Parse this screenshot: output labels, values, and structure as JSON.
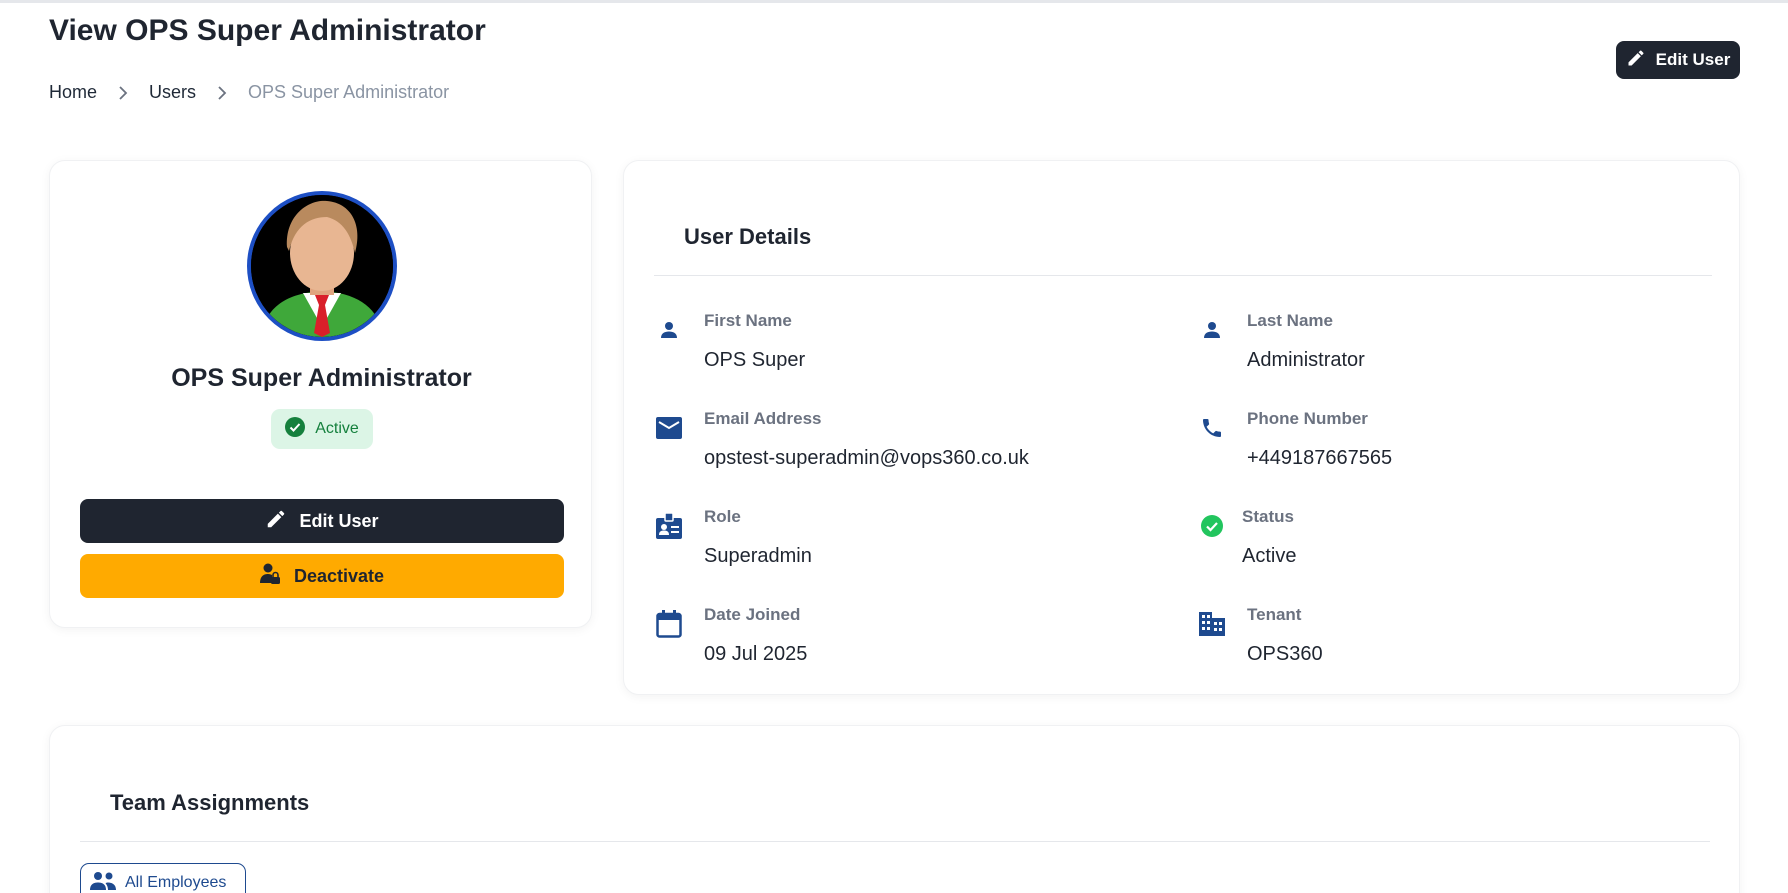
{
  "page": {
    "title": "View OPS Super Administrator"
  },
  "breadcrumb": {
    "home": "Home",
    "users": "Users",
    "current": "OPS Super Administrator"
  },
  "header": {
    "edit_label": "Edit User"
  },
  "profile": {
    "name": "OPS Super Administrator",
    "status": "Active",
    "edit_label": "Edit User",
    "deactivate_label": "Deactivate"
  },
  "details": {
    "title": "User Details",
    "first_name": {
      "label": "First Name",
      "value": "OPS Super",
      "icon": "person-icon"
    },
    "last_name": {
      "label": "Last Name",
      "value": "Administrator",
      "icon": "person-icon"
    },
    "email": {
      "label": "Email Address",
      "value": "opstest-superadmin@vops360.co.uk",
      "icon": "mail-icon"
    },
    "phone": {
      "label": "Phone Number",
      "value": "+449187667565",
      "icon": "phone-icon"
    },
    "role": {
      "label": "Role",
      "value": "Superadmin",
      "icon": "badge-icon"
    },
    "status": {
      "label": "Status",
      "value": "Active",
      "icon": "check-circle-icon"
    },
    "date_joined": {
      "label": "Date Joined",
      "value": "09 Jul 2025",
      "icon": "calendar-icon"
    },
    "tenant": {
      "label": "Tenant",
      "value": "OPS360",
      "icon": "building-icon"
    }
  },
  "team": {
    "title": "Team Assignments",
    "assignments": [
      "All Employees"
    ]
  },
  "colors": {
    "primary_dark": "#1f2530",
    "accent_yellow": "#ffaa00",
    "icon_blue": "#1e4a8f",
    "success_green": "#22c55e",
    "success_bg": "#dcf5e6"
  }
}
